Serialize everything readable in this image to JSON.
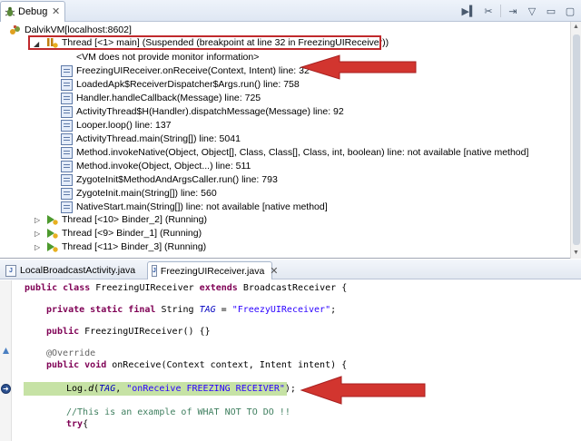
{
  "debug_view": {
    "tab_label": "Debug",
    "tab_close": "✕",
    "toolbar": [
      "resume-icon",
      "suspend-icon",
      "disconnect-icon",
      "step-icon",
      "view-menu-icon",
      "minimize-icon",
      "maximize-icon"
    ],
    "root": "DalvikVM[localhost:8602]",
    "suspended_thread": "Thread [<1> main] (Suspended (breakpoint at line 32 in FreezingUIReceiver))",
    "frames": [
      "<VM does not provide monitor information>",
      "FreezingUIReceiver.onReceive(Context, Intent) line: 32",
      "LoadedApk$ReceiverDispatcher$Args.run() line: 758",
      "Handler.handleCallback(Message) line: 725",
      "ActivityThread$H(Handler).dispatchMessage(Message) line: 92",
      "Looper.loop() line: 137",
      "ActivityThread.main(String[]) line: 5041",
      "Method.invokeNative(Object, Object[], Class, Class[], Class, int, boolean) line: not available [native method]",
      "Method.invoke(Object, Object...) line: 511",
      "ZygoteInit$MethodAndArgsCaller.run() line: 793",
      "ZygoteInit.main(String[]) line: 560",
      "NativeStart.main(String[]) line: not available [native method]"
    ],
    "running_threads": [
      "Thread [<10> Binder_2] (Running)",
      "Thread [<9> Binder_1] (Running)",
      "Thread [<11> Binder_3] (Running)"
    ]
  },
  "editor": {
    "tabs": [
      {
        "label": "LocalBroadcastActivity.java",
        "active": false
      },
      {
        "label": "FreezingUIReceiver.java",
        "active": true
      }
    ],
    "tab_close": "✕",
    "code": {
      "l1_kw1": "public class ",
      "l1_name": "FreezingUIReceiver ",
      "l1_kw2": "extends ",
      "l1_rest": "BroadcastReceiver {",
      "l2_kw": "private static final ",
      "l2_type": "String ",
      "l2_field": "TAG",
      "l2_eq": " = ",
      "l2_str": "\"FreezyUIReceiver\"",
      "l2_end": ";",
      "l3_kw": "public ",
      "l3_rest": "FreezingUIReceiver() {}",
      "l4_ann": "@Override",
      "l5_kw1": "public ",
      "l5_kw2": "void ",
      "l5_rest": "onReceive(Context context, Intent intent) {",
      "l6_a": "Log.",
      "l6_b": "d",
      "l6_c": "(",
      "l6_field": "TAG",
      "l6_d": ", ",
      "l6_str": "\"onReceive FREEZING RECEIVER\"",
      "l6_e": ");",
      "l7_cmt": "//This is an example of WHAT NOT TO DO !!",
      "l8_kw": "try",
      "l8_rest": "{"
    }
  },
  "colors": {
    "annotation_red": "#c0292c",
    "highlight_line": "#c6e2a5",
    "keyword": "#7f0055",
    "string": "#2a00ff"
  }
}
